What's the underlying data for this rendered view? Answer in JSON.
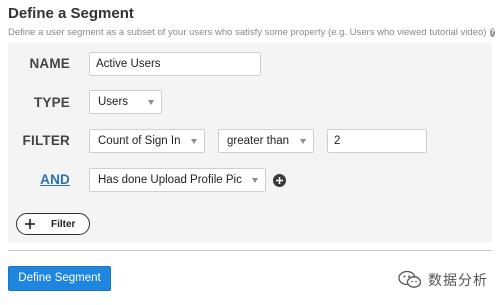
{
  "header": {
    "title": "Define a Segment",
    "subtitle": "Define a user segment as a subset of your users who satisfy some property (e.g. Users who viewed tutorial video)",
    "help_icon_glyph": "?"
  },
  "form": {
    "name": {
      "label": "NAME",
      "value": "Active Users"
    },
    "type": {
      "label": "TYPE",
      "selected": "Users"
    },
    "filter": {
      "label": "FILTER",
      "metric_selected": "Count of Sign In",
      "operator_selected": "greater than",
      "value": "2"
    },
    "and_condition": {
      "label": "AND",
      "selected": "Has done Upload Profile Pic"
    }
  },
  "add_filter_button": {
    "label": "Filter"
  },
  "define_segment_button": {
    "label": "Define Segment"
  },
  "watermark": {
    "text": "数据分析"
  },
  "colors": {
    "link": "#2b6fb6",
    "primary_button": "#1f86e0",
    "panel_bg": "#f4f4f4"
  },
  "icons": [
    "help-icon",
    "chevron-down-icon",
    "add-circle-icon",
    "plus-icon",
    "wechat-icon"
  ]
}
